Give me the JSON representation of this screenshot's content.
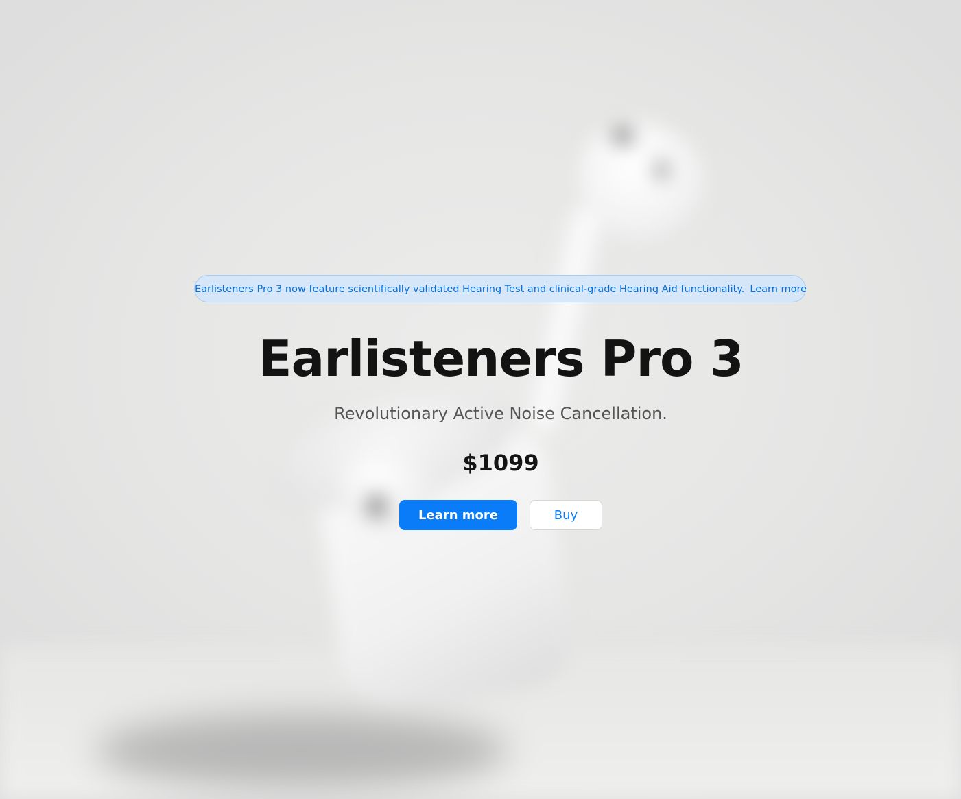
{
  "notice": {
    "text": "Earlisteners Pro 3 now feature scientifically validated Hearing Test and clinical-grade Hearing Aid functionality.",
    "link_label": "Learn more",
    "accent_color": "#0a6fd6",
    "background_color": "#d2e6fa"
  },
  "hero": {
    "title": "Earlisteners Pro 3",
    "subtitle": "Revolutionary Active Noise Cancellation.",
    "price": "$1099",
    "product_image": "blurred-earbuds-and-charging-case"
  },
  "actions": {
    "primary_label": "Learn more",
    "secondary_label": "Buy",
    "primary_color": "#0a7cf8"
  }
}
